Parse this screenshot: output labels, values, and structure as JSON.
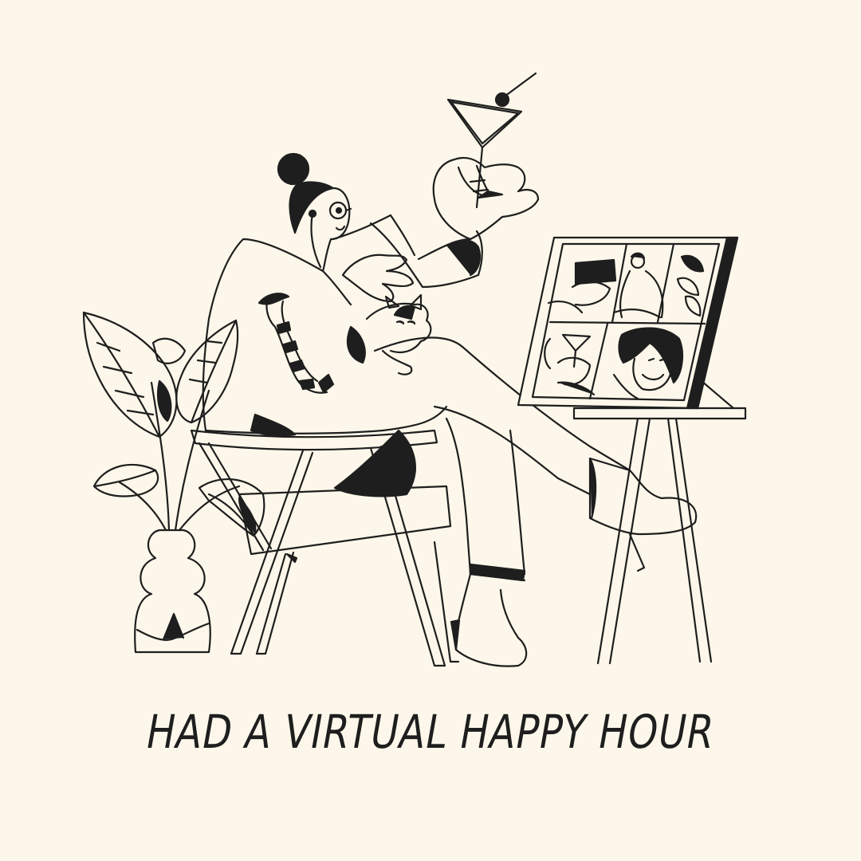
{
  "caption": "HAD A VIRTUAL HAPPY HOUR",
  "colors": {
    "background": "#fcf7ea",
    "ink": "#1e1e1e"
  },
  "illustration": {
    "subjects": [
      "woman-with-martini",
      "cat",
      "chair",
      "potted-plant",
      "tablet-video-call",
      "tablet-stand"
    ]
  }
}
